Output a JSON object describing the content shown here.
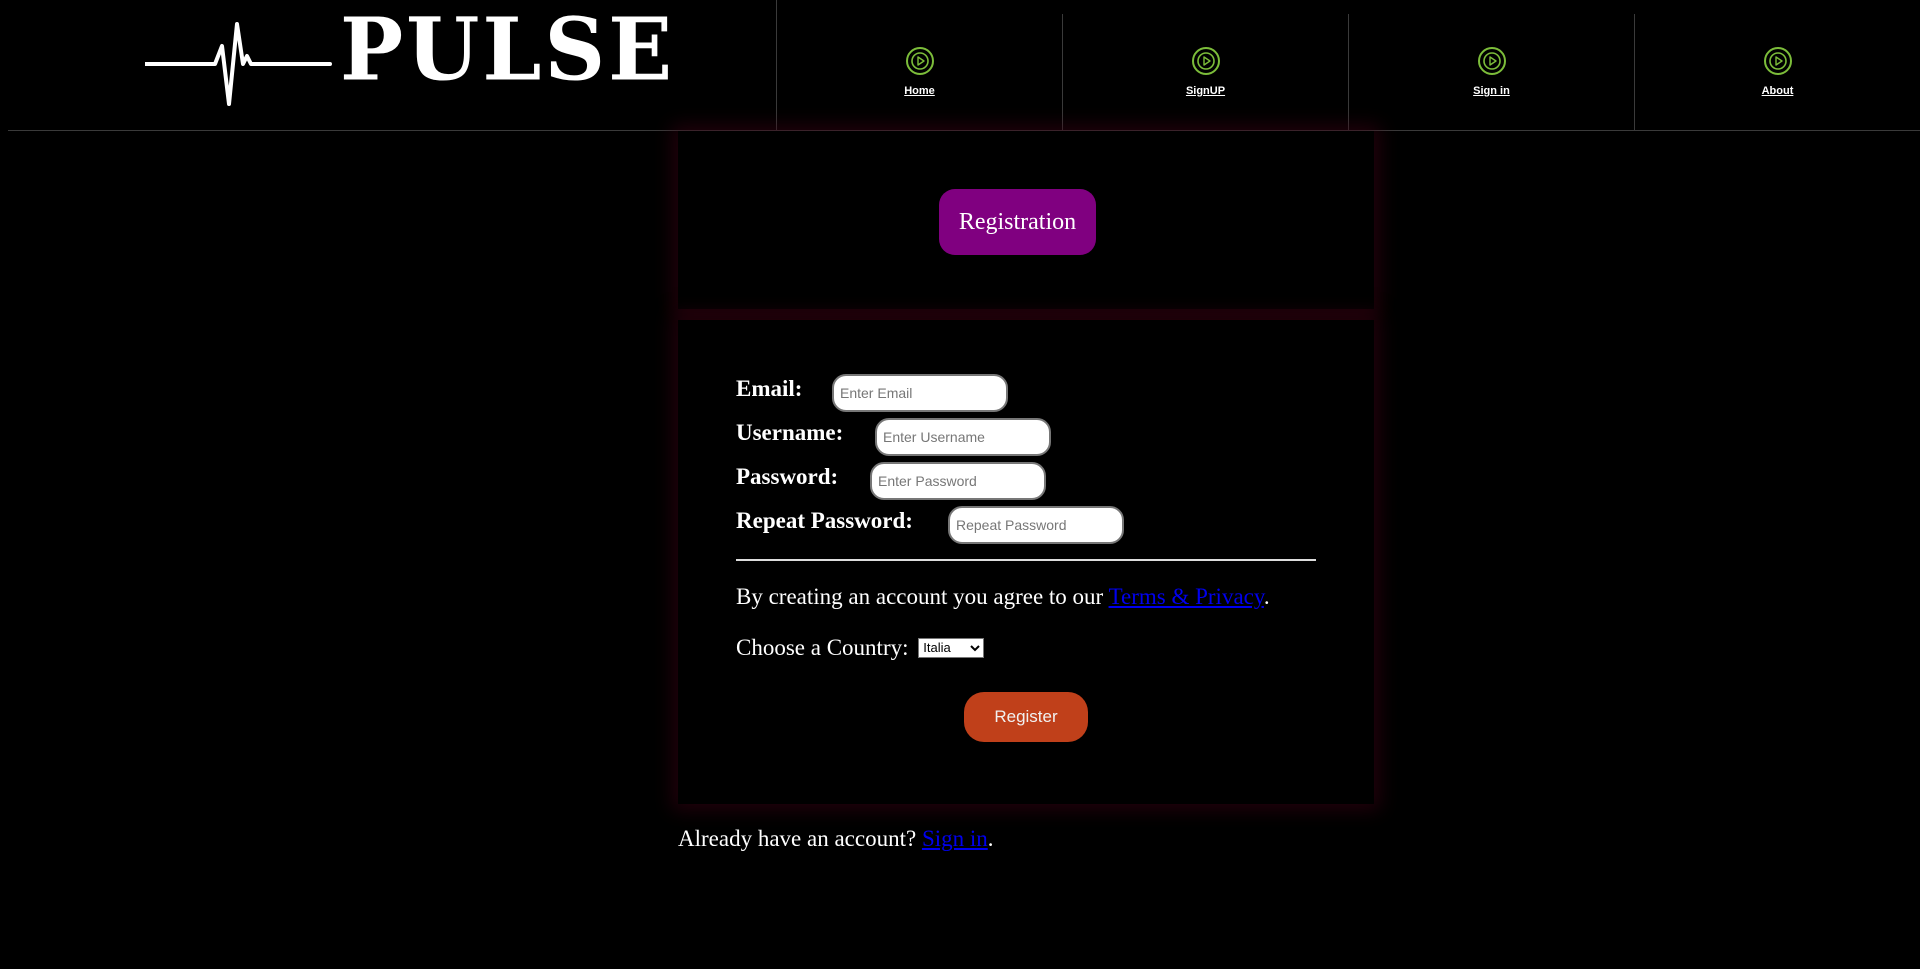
{
  "brand": {
    "name": "PULSE"
  },
  "nav": {
    "items": [
      {
        "label": "Home",
        "icon": "play-circle-icon"
      },
      {
        "label": "SignUP",
        "icon": "play-circle-icon"
      },
      {
        "label": "Sign in",
        "icon": "play-circle-icon"
      },
      {
        "label": "About",
        "icon": "play-circle-icon"
      }
    ],
    "icon_color": "#7cbd3a"
  },
  "registration": {
    "badge": "Registration",
    "badge_color": "#800080",
    "fields": {
      "email": {
        "label": "Email:",
        "placeholder": "Enter Email",
        "value": ""
      },
      "username": {
        "label": "Username:",
        "placeholder": "Enter Username",
        "value": ""
      },
      "password": {
        "label": "Password:",
        "placeholder": "Enter Password",
        "value": ""
      },
      "repeat_password": {
        "label": "Repeat Password:",
        "placeholder": "Repeat Password",
        "value": ""
      }
    },
    "terms_prefix": "By creating an account you agree to our ",
    "terms_link": "Terms & Privacy",
    "terms_suffix": ".",
    "country_label": "Choose a Country:",
    "country_selected": "Italia",
    "register_label": "Register",
    "register_color": "#c0401a"
  },
  "footer": {
    "prefix": "Already have an account? ",
    "signin_link": "Sign in",
    "suffix": "."
  }
}
